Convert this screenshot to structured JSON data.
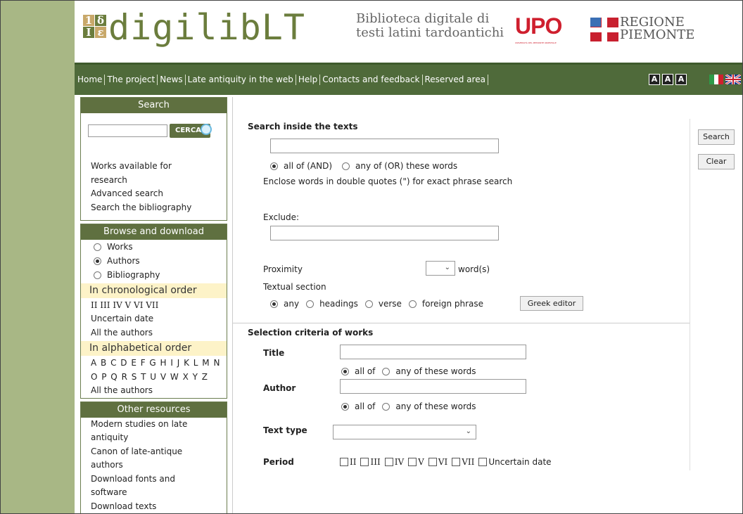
{
  "header": {
    "logo_letters": [
      "1",
      "δ",
      "Ι",
      "ε"
    ],
    "brand": "digilibLT",
    "tagline_line1": "Biblioteca digitale di",
    "tagline_line2": "testi latini tardoantichi",
    "upo": "UPO",
    "upo_subtitle": "UNIVERSITÀ DEL PIEMONTE ORIENTALE",
    "regione_line1": "REGIONE",
    "regione_line2": "PIEMONTE"
  },
  "nav": {
    "items": [
      "Home",
      "The project",
      "News",
      "Late antiquity in the web",
      "Help",
      "Contacts and feedback",
      "Reserved area"
    ],
    "font_sizes": [
      "A",
      "A",
      "A"
    ],
    "languages": [
      "italian-flag-icon",
      "uk-flag-icon"
    ]
  },
  "sidebar": {
    "search": {
      "title": "Search",
      "input_value": "",
      "button": "CERCA",
      "links": [
        "Works available for",
        "research",
        "Advanced search",
        "Search the bibliography"
      ]
    },
    "browse": {
      "title": "Browse and download",
      "options": [
        "Works",
        "Authors",
        "Bibliography"
      ],
      "selected": "Authors",
      "chrono_title": "In chronological order",
      "periods": "II  III  IV  V  VI  VII",
      "uncertain": "Uncertain date",
      "all_authors_1": "All the authors",
      "alpha_title": "In alphabetical order",
      "letters_1": "A B C D E F G H I J K L M N",
      "letters_2": "O P Q R S T U V W X Y Z",
      "all_authors_2": "All the authors"
    },
    "other": {
      "title": "Other resources",
      "links": [
        "Modern studies on late",
        "antiquity",
        "Canon of late-antique",
        "authors",
        "Download fonts and",
        "software",
        "Download texts"
      ]
    }
  },
  "main": {
    "search_inside": "Search inside the texts",
    "search_input": "",
    "mode_and": "all of (AND)",
    "mode_or": "any of (OR) these words",
    "mode_selected": "AND",
    "phrase_hint": "Enclose words in double quotes (\") for exact phrase search",
    "exclude_label": "Exclude:",
    "exclude_input": "",
    "proximity_label": "Proximity",
    "proximity_value": "",
    "proximity_unit": "word(s)",
    "section_label": "Textual section",
    "sections": [
      "any",
      "headings",
      "verse",
      "foreign phrase"
    ],
    "section_selected": "any",
    "greek_editor": "Greek editor",
    "criteria_title": "Selection criteria of works",
    "title_label": "Title",
    "title_input": "",
    "title_all": "all of",
    "title_any": "any of these words",
    "author_label": "Author",
    "author_input": "",
    "author_all": "all of",
    "author_any": "any of these words",
    "text_type_label": "Text type",
    "text_type_value": "",
    "period_label": "Period",
    "periods": [
      "II",
      "III",
      "IV",
      "V",
      "VI",
      "VII",
      "Uncertain date"
    ]
  },
  "actions": {
    "search": "Search",
    "clear": "Clear"
  },
  "colors": {
    "nav_bg": "#4f6a3a",
    "sidebar_head": "#5f7040",
    "left_strip": "#a8b785",
    "brand_green": "#6b7d3d",
    "upo_red": "#cf1f2e",
    "subhead_bg": "#fdf3c8"
  }
}
